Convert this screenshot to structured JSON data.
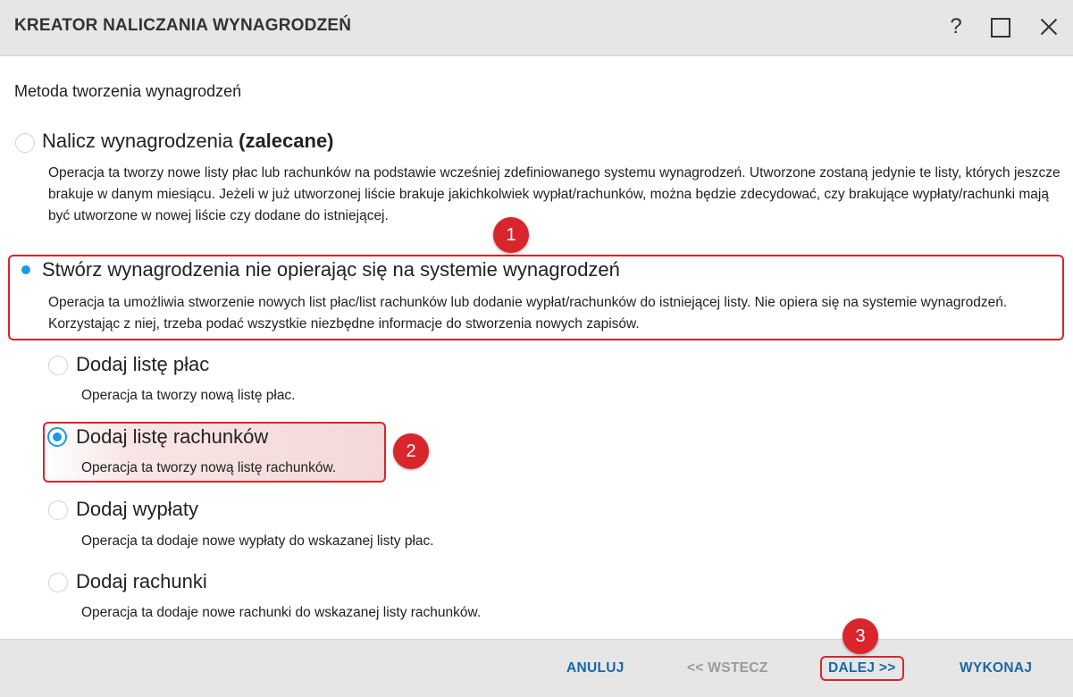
{
  "window": {
    "title": "KREATOR NALICZANIA WYNAGRODZEŃ",
    "help_label": "?"
  },
  "section_title": "Metoda tworzenia wynagrodzeń",
  "options": [
    {
      "title": "Nalicz wynagrodzenia",
      "title_suffix": "(zalecane)",
      "description": "Operacja ta tworzy nowe listy płac lub rachunków na podstawie wcześniej zdefiniowanego systemu wynagrodzeń. Utworzone zostaną jedynie te listy, których jeszcze brakuje w danym miesiącu. Jeżeli w już utworzonej liście brakuje jakichkolwiek wypłat/rachunków, można będzie zdecydować, czy brakujące wypłaty/rachunki mają być utworzone w nowej liście czy dodane do istniejącej.",
      "selected": false
    },
    {
      "title": "Stwórz wynagrodzenia nie opierając się na systemie wynagrodzeń",
      "description": "Operacja ta umożliwia stworzenie nowych list płac/list rachunków lub dodanie wypłat/rachunków do istniejącej listy. Nie opiera się na systemie wynagrodzeń. Korzystając z niej, trzeba podać wszystkie niezbędne informacje do stworzenia nowych zapisów.",
      "selected": true
    }
  ],
  "sub_options": [
    {
      "title": "Dodaj listę płac",
      "description": "Operacja ta tworzy nową listę płac.",
      "selected": false
    },
    {
      "title": "Dodaj listę rachunków",
      "description": "Operacja ta tworzy nową listę rachunków.",
      "selected": true
    },
    {
      "title": "Dodaj wypłaty",
      "description": "Operacja ta dodaje nowe wypłaty do wskazanej listy płac.",
      "selected": false
    },
    {
      "title": "Dodaj rachunki",
      "description": "Operacja ta dodaje nowe rachunki do wskazanej listy rachunków.",
      "selected": false
    }
  ],
  "annotations": [
    "1",
    "2",
    "3"
  ],
  "footer": {
    "cancel": "ANULUJ",
    "back": "<< WSTECZ",
    "next": "DALEJ >>",
    "execute": "WYKONAJ"
  },
  "colors": {
    "accent": "#1a9ae0",
    "button_text": "#1968a9",
    "annotation": "#d9252c"
  }
}
